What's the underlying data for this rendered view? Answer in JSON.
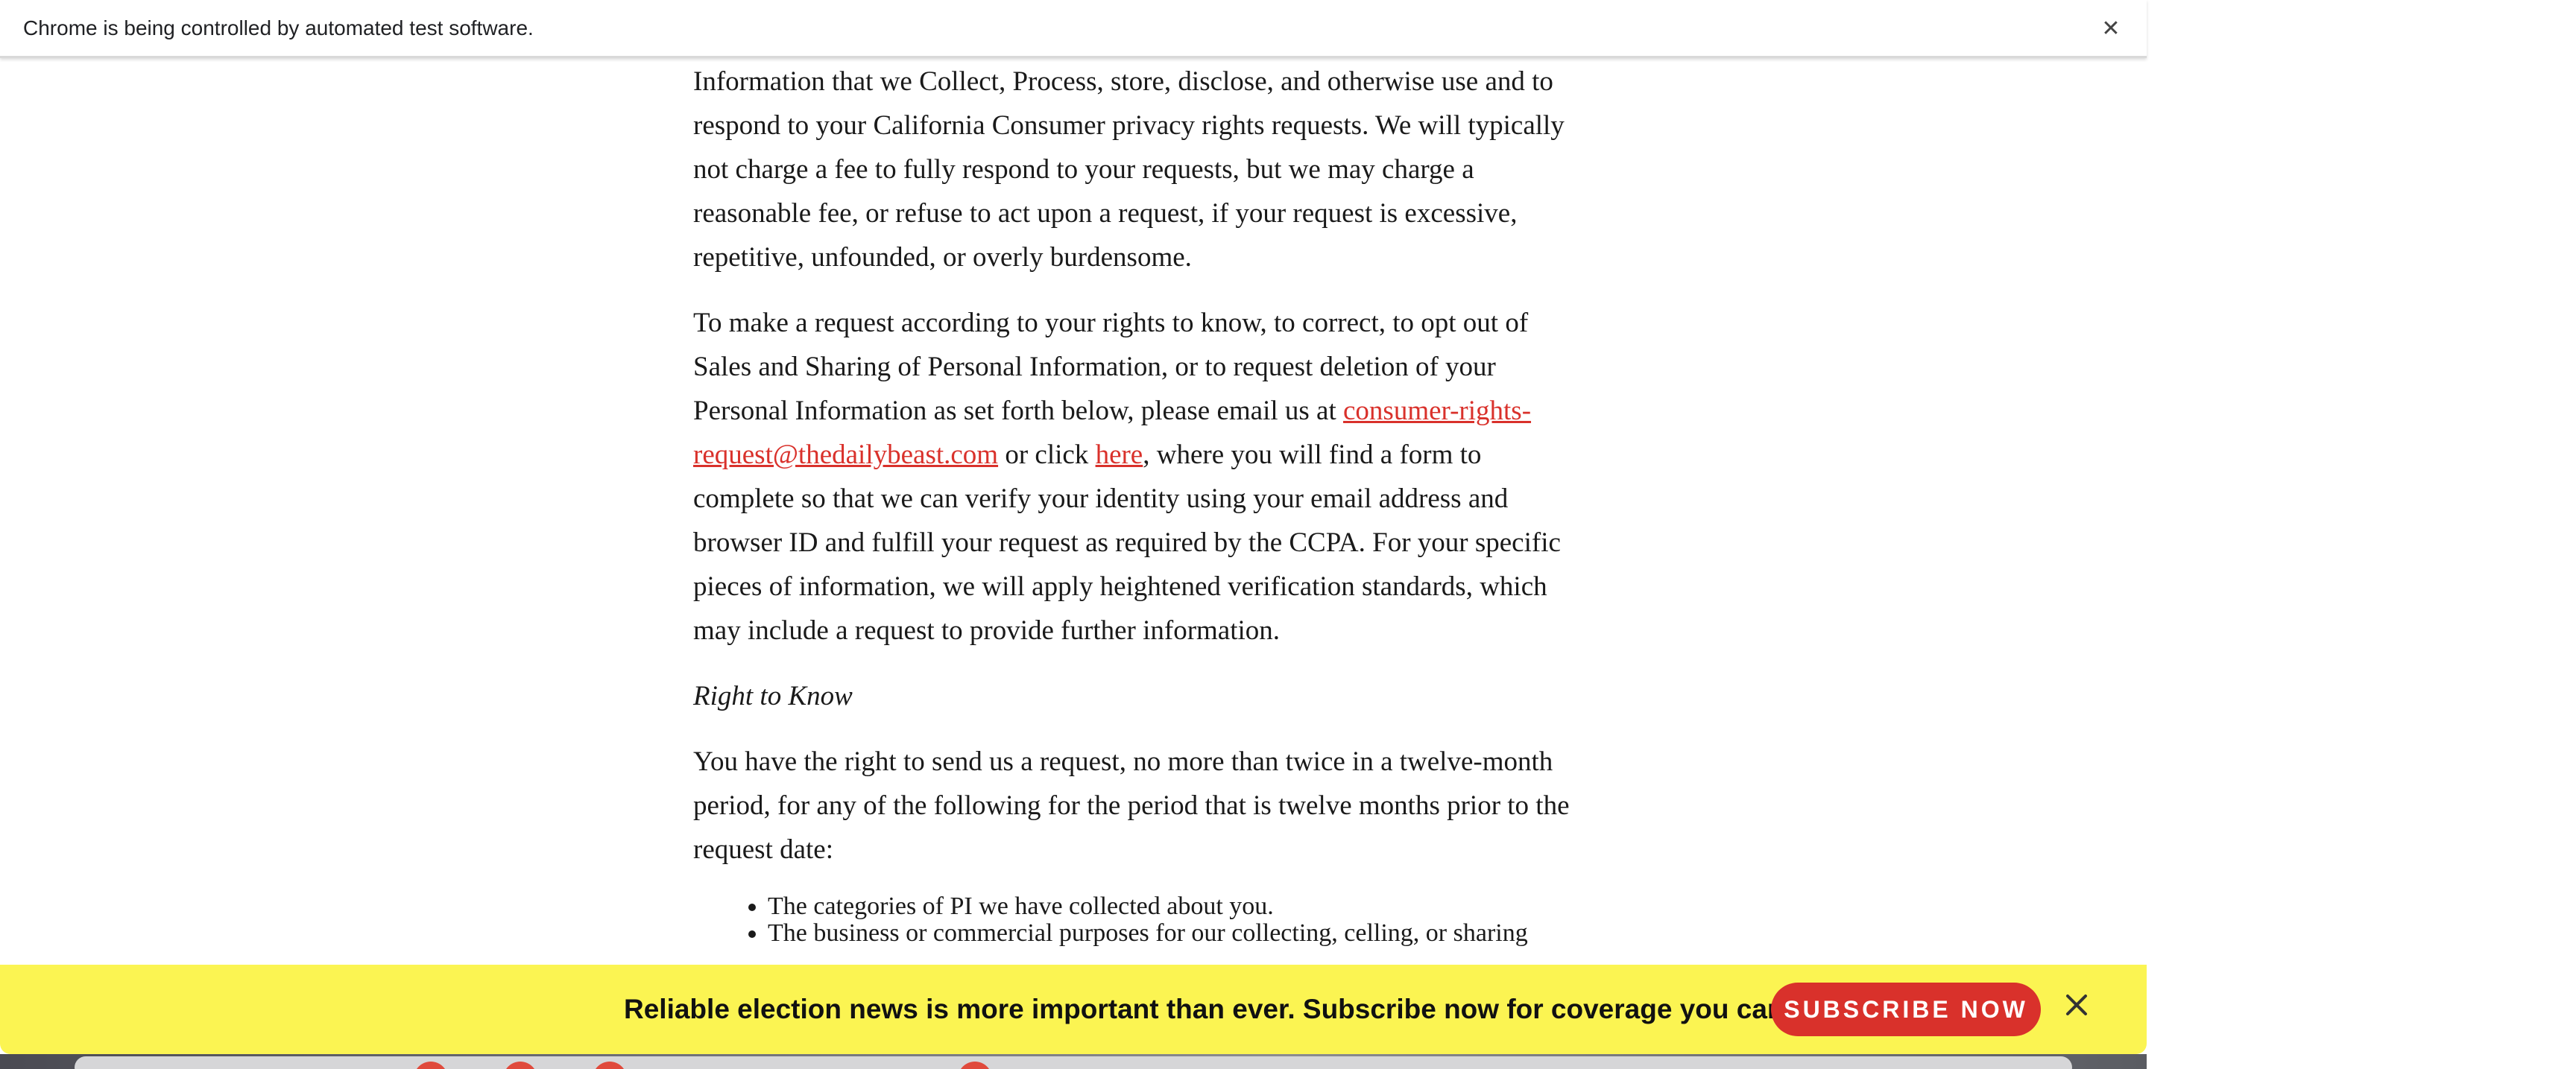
{
  "infobar": {
    "text": "Chrome is being controlled by automated test software.",
    "close_icon": "close-icon"
  },
  "article": {
    "paragraph1": "Information that we Collect, Process, store, disclose, and otherwise use and to respond to your California Consumer privacy rights requests. We will typically not charge a fee to fully respond to your requests, but we may charge a reasonable fee, or refuse to act upon a request, if your request is excessive, repetitive, unfounded, or overly burdensome.",
    "paragraph2_part1": "To make a request according to your rights to know, to correct, to opt out of Sales and Sharing of Personal Information, or to request deletion of your Personal Information as set forth below, please email us at ",
    "paragraph2_email_link": "consumer-rights-request@thedailybeast.com",
    "paragraph2_part2": " or click ",
    "paragraph2_here_link": "here",
    "paragraph2_part3": ", where you will find a form to complete so that we can verify your identity using your email address and browser ID and fulfill your request as required by the CCPA. For your specific pieces of information, we will apply heightened verification standards, which may include a request to provide further information.",
    "subhead": "Right to Know",
    "paragraph3": "You have the right to send us a request, no more than twice in a twelve-month period, for any of the following for the period that is twelve months prior to the request date:",
    "list_items": [
      "The categories of PI we have collected about you.",
      "The business or commercial purposes for our collecting, celling, or sharing"
    ]
  },
  "promo": {
    "text": "Reliable election news is more important than ever. Subscribe now for coverage you can count on.",
    "button_label": "SUBSCRIBE NOW",
    "close_icon": "close-icon"
  },
  "colors": {
    "link": "#d9312b",
    "promo_background": "#fbf452",
    "button_background": "#d9312b"
  }
}
